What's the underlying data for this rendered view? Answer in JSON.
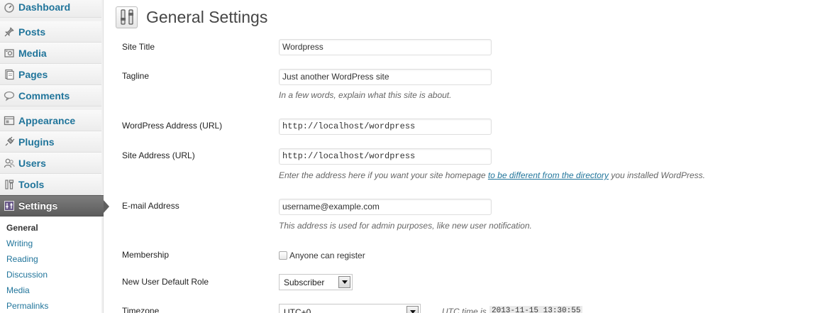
{
  "sidebar": {
    "items": [
      {
        "label": "Dashboard",
        "icon": "dashboard-icon"
      },
      {
        "label": "Posts",
        "icon": "pin-icon"
      },
      {
        "label": "Media",
        "icon": "media-icon"
      },
      {
        "label": "Pages",
        "icon": "pages-icon"
      },
      {
        "label": "Comments",
        "icon": "comments-icon"
      },
      {
        "label": "Appearance",
        "icon": "appearance-icon"
      },
      {
        "label": "Plugins",
        "icon": "plugins-icon"
      },
      {
        "label": "Users",
        "icon": "users-icon"
      },
      {
        "label": "Tools",
        "icon": "tools-icon"
      },
      {
        "label": "Settings",
        "icon": "settings-icon",
        "current": true
      }
    ],
    "submenu": [
      "General",
      "Writing",
      "Reading",
      "Discussion",
      "Media",
      "Permalinks"
    ],
    "submenu_current": "General"
  },
  "page": {
    "title": "General Settings"
  },
  "form": {
    "site_title": {
      "label": "Site Title",
      "value": "Wordpress"
    },
    "tagline": {
      "label": "Tagline",
      "value": "Just another WordPress site",
      "description": "In a few words, explain what this site is about."
    },
    "wp_address": {
      "label": "WordPress Address (URL)",
      "value": "http://localhost/wordpress"
    },
    "site_address": {
      "label": "Site Address (URL)",
      "value": "http://localhost/wordpress",
      "desc_before": "Enter the address here if you want your site homepage ",
      "desc_link": "to be different from the directory",
      "desc_after": " you installed WordPress."
    },
    "email": {
      "label": "E-mail Address",
      "value": "username@example.com",
      "description": "This address is used for admin purposes, like new user notification."
    },
    "membership": {
      "label": "Membership",
      "checkbox_label": "Anyone can register",
      "checked": false
    },
    "default_role": {
      "label": "New User Default Role",
      "value": "Subscriber"
    },
    "timezone": {
      "label": "Timezone",
      "value": "UTC+0",
      "utc_label": "UTC time is",
      "utc_time": "2013-11-15 13:30:55"
    }
  },
  "colors": {
    "link": "#21759b",
    "sidebar_bg": "#f1f1f1",
    "current_menu_bg": "#5f5f5f"
  }
}
